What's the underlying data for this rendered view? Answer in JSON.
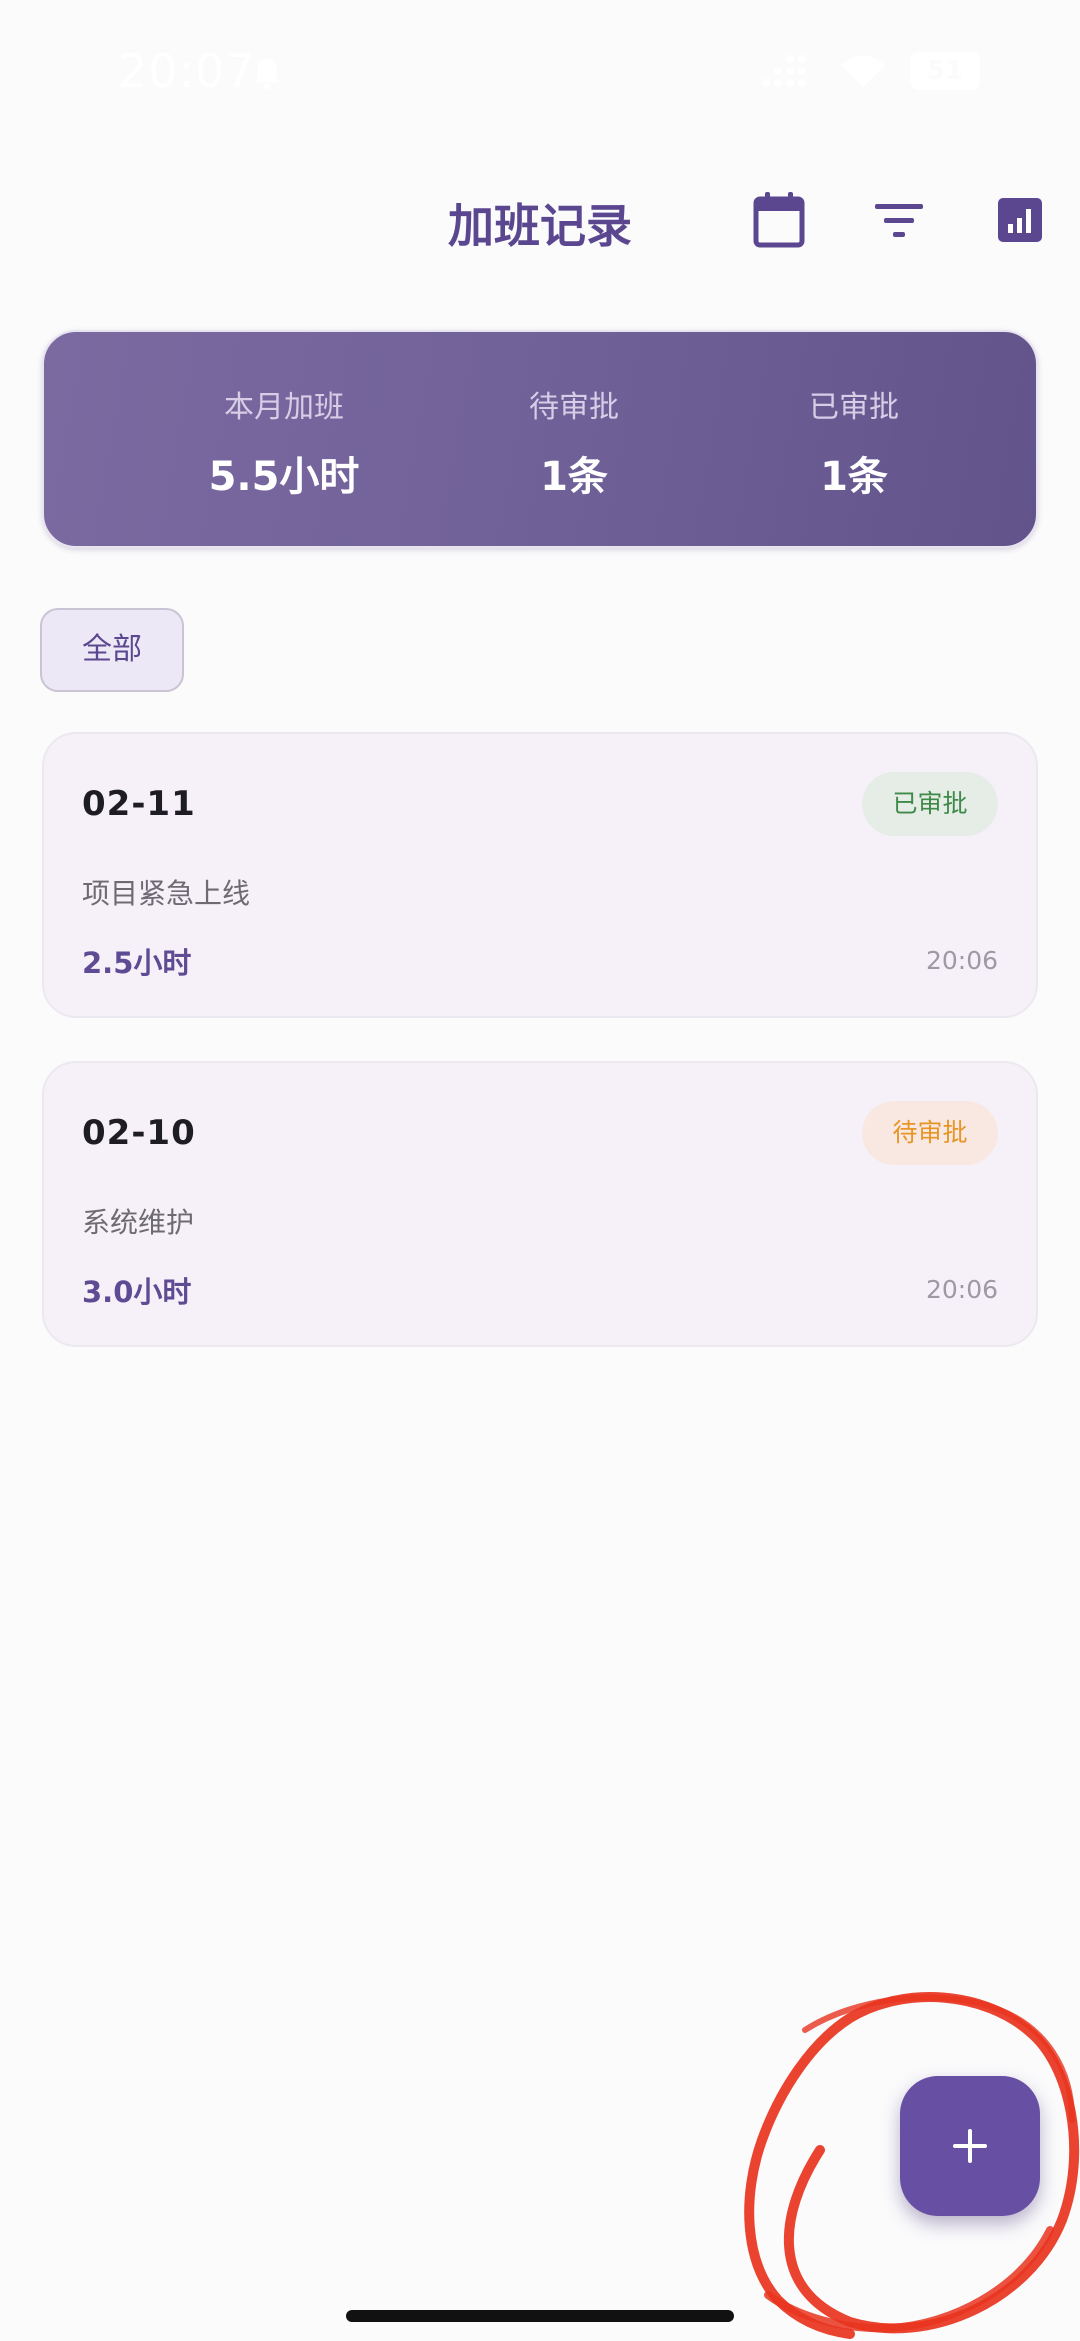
{
  "status_bar": {
    "time": "20:07",
    "battery": "51"
  },
  "header": {
    "title": "加班记录",
    "icons": [
      "calendar-icon",
      "filter-icon",
      "stats-chart-icon"
    ],
    "accent_color": "#5a4790"
  },
  "summary": {
    "monthly_overtime_label": "本月加班",
    "monthly_overtime_value": "5.5小时",
    "pending_label": "待审批",
    "pending_value": "1条",
    "approved_label": "已审批",
    "approved_value": "1条"
  },
  "filter": {
    "selected_label": "全部"
  },
  "records": [
    {
      "date": "02-11",
      "status": "已审批",
      "description": "项目紧急上线",
      "hours": "2.5小时",
      "time": "20:06"
    },
    {
      "date": "02-10",
      "status": "待审批",
      "description": "系统维护",
      "hours": "3.0小时",
      "time": "20:06"
    }
  ],
  "fab": {
    "icon": "plus-icon",
    "color": "#6750a4"
  },
  "annotation": {
    "color": "#e8341f"
  }
}
